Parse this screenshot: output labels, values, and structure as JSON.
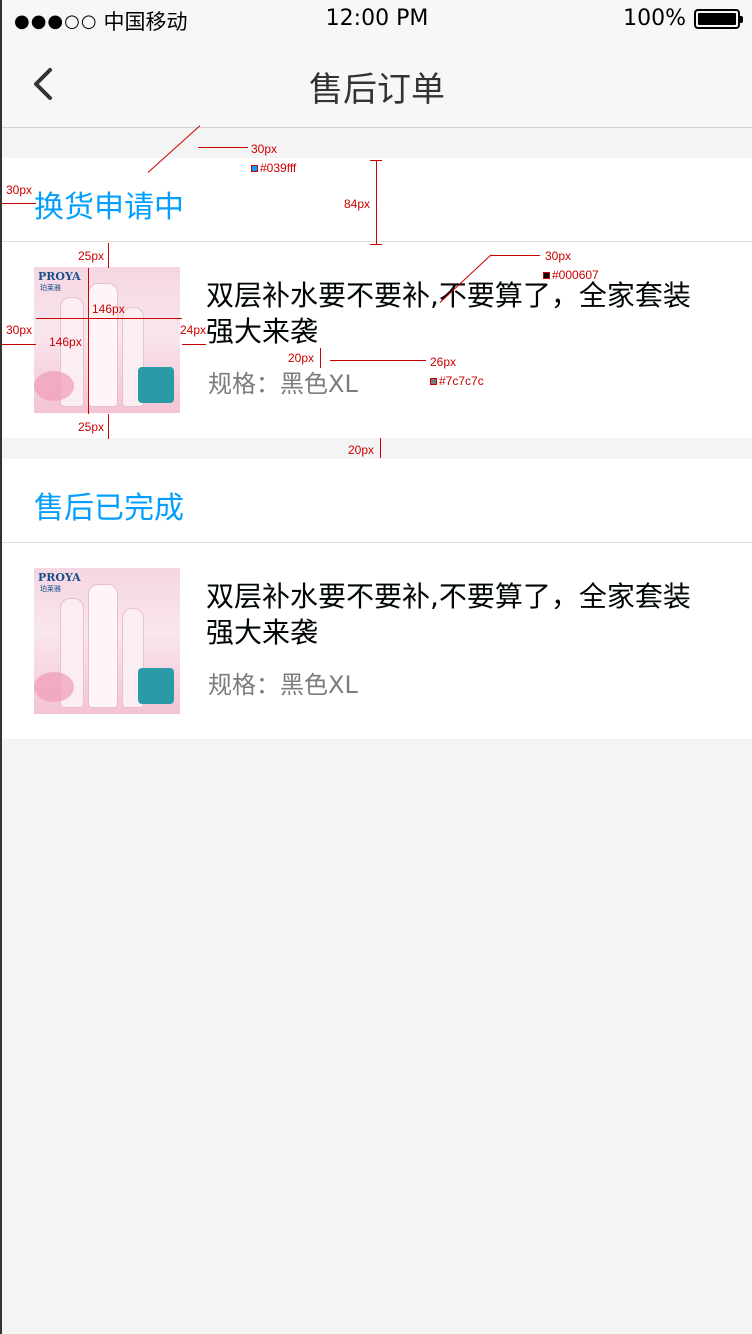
{
  "status_bar": {
    "signal": "●●●○○",
    "carrier": "中国移动",
    "time": "12:00 PM",
    "battery": "100%",
    "battery_level": 1.0
  },
  "nav": {
    "title": "售后订单",
    "back_icon": "chevron-left-icon"
  },
  "sections": [
    {
      "title": "换货申请中",
      "item": {
        "name": "双层补水要不要补,不要算了，全家套装强大来袭",
        "spec": "规格：黑色XL",
        "brand": "PROYA",
        "brand_sub": "珀莱雅"
      }
    },
    {
      "title": "售后已完成",
      "item": {
        "name": "双层补水要不要补,不要算了，全家套装强大来袭",
        "spec": "规格：黑色XL",
        "brand": "PROYA",
        "brand_sub": "珀莱雅"
      }
    }
  ],
  "annotations": {
    "a1": "30px",
    "a2": "#039fff",
    "a3": "30px",
    "a4": "84px",
    "a5": "25px",
    "a6": "146px",
    "a7": "146px",
    "a8": "30px",
    "a9": "24px",
    "a10": "30px",
    "a11": "#000607",
    "a12": "20px",
    "a13": "26px",
    "a14": "#7c7c7c",
    "a15": "25px",
    "a16": "20px"
  },
  "colors": {
    "accent": "#039fff",
    "item_text": "#000607",
    "spec_text": "#7c7c7c",
    "background": "#f4f4f4"
  }
}
